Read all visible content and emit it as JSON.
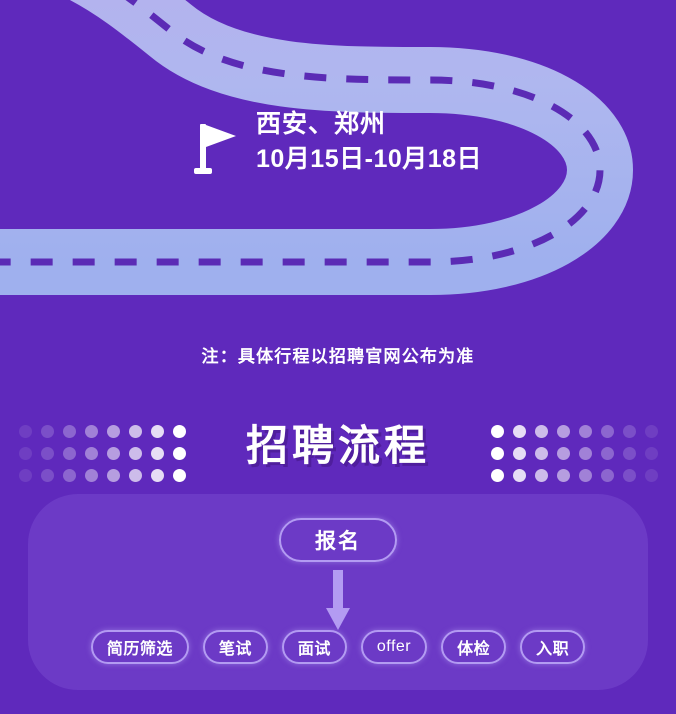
{
  "colors": {
    "background": "#5F29BC",
    "road": "#A9B6EF",
    "road_top": "#B4AFEC",
    "road_dash": "#5B2BB5",
    "card": "#6C3AC6",
    "pill_border": "#B39BF2",
    "text": "#FFFFFF",
    "dot": "#FFFFFF"
  },
  "route": {
    "flag_icon": "flag-icon",
    "cities": "西安、郑州",
    "dates": "10月15日-10月18日"
  },
  "note": {
    "text": "注：具体行程以招聘官网公布为准"
  },
  "section": {
    "title": "招聘流程",
    "dots": {
      "columns": 8,
      "rows": 3
    }
  },
  "flow": {
    "apply": {
      "label": "报名"
    },
    "arrow_icon": "arrow-down-icon",
    "steps": [
      {
        "label": "简历筛选",
        "script": "cjk"
      },
      {
        "label": "笔试",
        "script": "cjk"
      },
      {
        "label": "面试",
        "script": "cjk"
      },
      {
        "label": "offer",
        "script": "latin"
      },
      {
        "label": "体检",
        "script": "cjk"
      },
      {
        "label": "入职",
        "script": "cjk"
      }
    ]
  }
}
